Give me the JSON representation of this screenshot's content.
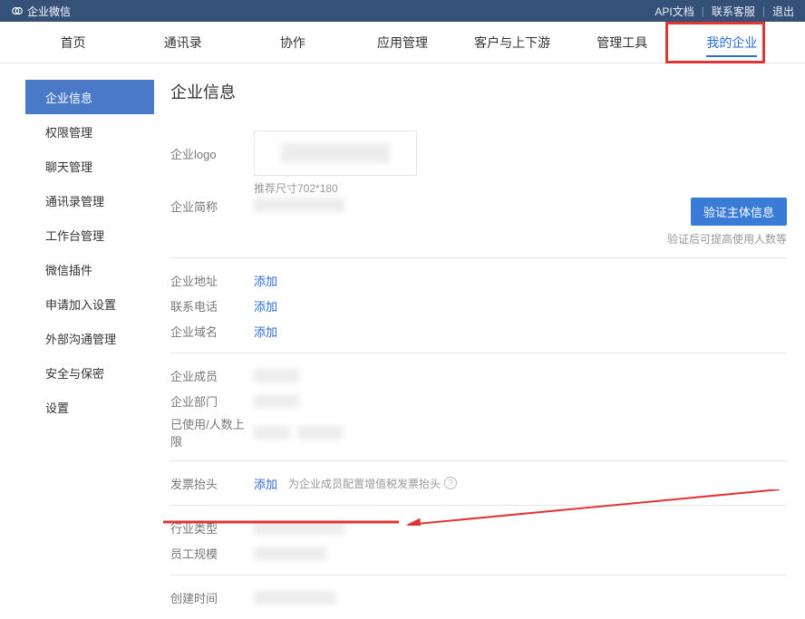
{
  "header": {
    "brand": "企业微信",
    "links": {
      "api": "API文档",
      "support": "联系客服",
      "logout": "退出"
    }
  },
  "nav": {
    "items": [
      "首页",
      "通讯录",
      "协作",
      "应用管理",
      "客户与上下游",
      "管理工具",
      "我的企业"
    ],
    "active_index": 6
  },
  "sidebar": {
    "items": [
      "企业信息",
      "权限管理",
      "聊天管理",
      "通讯录管理",
      "工作台管理",
      "微信插件",
      "申请加入设置",
      "外部沟通管理",
      "安全与保密",
      "设置"
    ],
    "active_index": 0
  },
  "content": {
    "title": "企业信息",
    "logo_section": {
      "label": "企业logo",
      "hint": "推荐尺寸702*180"
    },
    "short_section": {
      "label": "企业简称",
      "btn": "验证主体信息",
      "note": "验证后可提高使用人数等"
    },
    "section_contact": {
      "addr_label": "企业地址",
      "addr_action": "添加",
      "tel_label": "联系电话",
      "tel_action": "添加",
      "domain_label": "企业域名",
      "domain_action": "添加"
    },
    "section_members": {
      "member_label": "企业成员",
      "dept_label": "企业部门",
      "quota_label": "已使用/人数上限"
    },
    "section_invoice": {
      "invoice_label": "发票抬头",
      "invoice_action": "添加",
      "invoice_desc": "为企业成员配置增值税发票抬头"
    },
    "section_industry": {
      "industry_label": "行业类型",
      "scale_label": "员工规模"
    },
    "section_created": {
      "created_label": "创建时间"
    }
  }
}
